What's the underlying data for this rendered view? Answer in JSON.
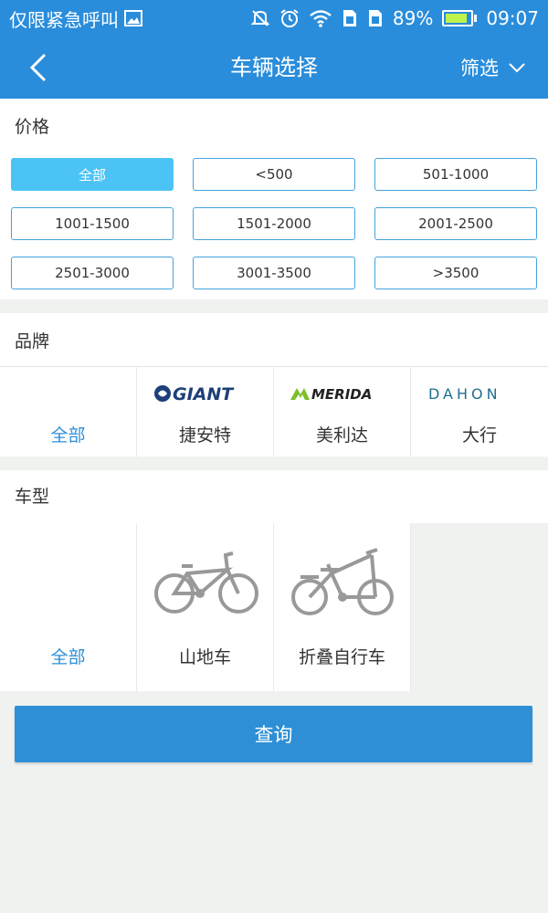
{
  "status_bar": {
    "left_text": "仅限紧急呼叫",
    "battery": "89%",
    "battery_level": 0.89,
    "time": "09:07",
    "icons": [
      "image-icon",
      "mute-icon",
      "alarm-icon",
      "wifi-icon",
      "sim1-icon",
      "sim2-icon",
      "battery-icon"
    ]
  },
  "app_bar": {
    "title": "车辆选择",
    "filter_label": "筛选",
    "back_icon": "chevron-left-icon",
    "filter_icon": "chevron-down-icon"
  },
  "price": {
    "heading": "价格",
    "options": [
      "全部",
      "<500",
      "501-1000",
      "1001-1500",
      "1501-2000",
      "2001-2500",
      "2501-3000",
      "3001-3500",
      ">3500"
    ],
    "selected": "全部"
  },
  "brand": {
    "heading": "品牌",
    "items": [
      {
        "label": "全部",
        "logo": ""
      },
      {
        "label": "捷安特",
        "logo": "GIANT"
      },
      {
        "label": "美利达",
        "logo": "MERIDA"
      },
      {
        "label": "大行",
        "logo": "DAHON"
      }
    ],
    "selected": "全部"
  },
  "type": {
    "heading": "车型",
    "items": [
      {
        "label": "全部",
        "icon": ""
      },
      {
        "label": "山地车",
        "icon": "mountain-bike-icon"
      },
      {
        "label": "折叠自行车",
        "icon": "folding-bike-icon"
      }
    ],
    "selected": "全部"
  },
  "query_label": "查询",
  "colors": {
    "primary": "#2a8ddb",
    "selected_chip": "#4cc3f5",
    "chip_border": "#46a3dd",
    "background": "#f0f2f0",
    "giant_blue": "#1d3f7a",
    "merida_green": "#7bbf2a",
    "dahon_teal": "#1e6f8f"
  }
}
